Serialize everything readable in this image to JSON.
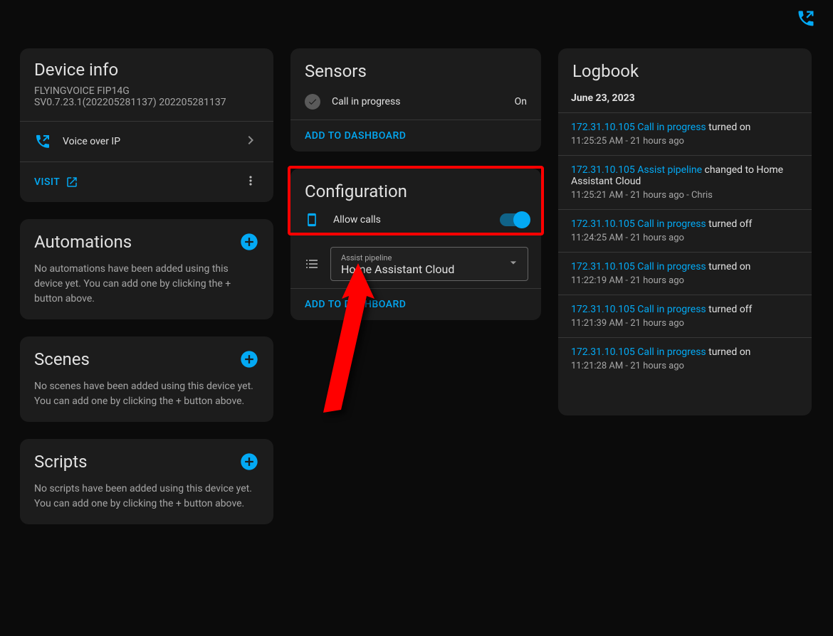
{
  "topbar": {
    "voip_icon": "voip"
  },
  "deviceInfo": {
    "title": "Device info",
    "model": "FLYINGVOICE FIP14G",
    "firmware": "SV0.7.23.1(202205281137) 202205281137",
    "integration_label": "Voice over IP",
    "visit_label": "VISIT"
  },
  "automations": {
    "title": "Automations",
    "empty": "No automations have been added using this device yet. You can add one by clicking the + button above."
  },
  "scenes": {
    "title": "Scenes",
    "empty": "No scenes have been added using this device yet. You can add one by clicking the + button above."
  },
  "scripts": {
    "title": "Scripts",
    "empty": "No scripts have been added using this device yet. You can add one by clicking the + button above."
  },
  "sensors": {
    "title": "Sensors",
    "item_label": "Call in progress",
    "item_value": "On",
    "add_dash": "ADD TO DASHBOARD"
  },
  "config": {
    "title": "Configuration",
    "allow_calls": "Allow calls",
    "select_label": "Assist pipeline",
    "select_value": "Home Assistant Cloud",
    "add_dash": "ADD TO DASHBOARD"
  },
  "logbook": {
    "title": "Logbook",
    "date": "June 23, 2023",
    "items": [
      {
        "link": "172.31.10.105 Call in progress",
        "rest": " turned on",
        "sub": "11:25:25 AM - 21 hours ago"
      },
      {
        "link": "172.31.10.105 Assist pipeline",
        "rest": " changed to Home Assistant Cloud",
        "sub": "11:25:21 AM - 21 hours ago - Chris"
      },
      {
        "link": "172.31.10.105 Call in progress",
        "rest": " turned off",
        "sub": "11:24:25 AM - 21 hours ago"
      },
      {
        "link": "172.31.10.105 Call in progress",
        "rest": " turned on",
        "sub": "11:22:19 AM - 21 hours ago"
      },
      {
        "link": "172.31.10.105 Call in progress",
        "rest": " turned off",
        "sub": "11:21:39 AM - 21 hours ago"
      },
      {
        "link": "172.31.10.105 Call in progress",
        "rest": " turned on",
        "sub": "11:21:28 AM - 21 hours ago"
      }
    ]
  }
}
